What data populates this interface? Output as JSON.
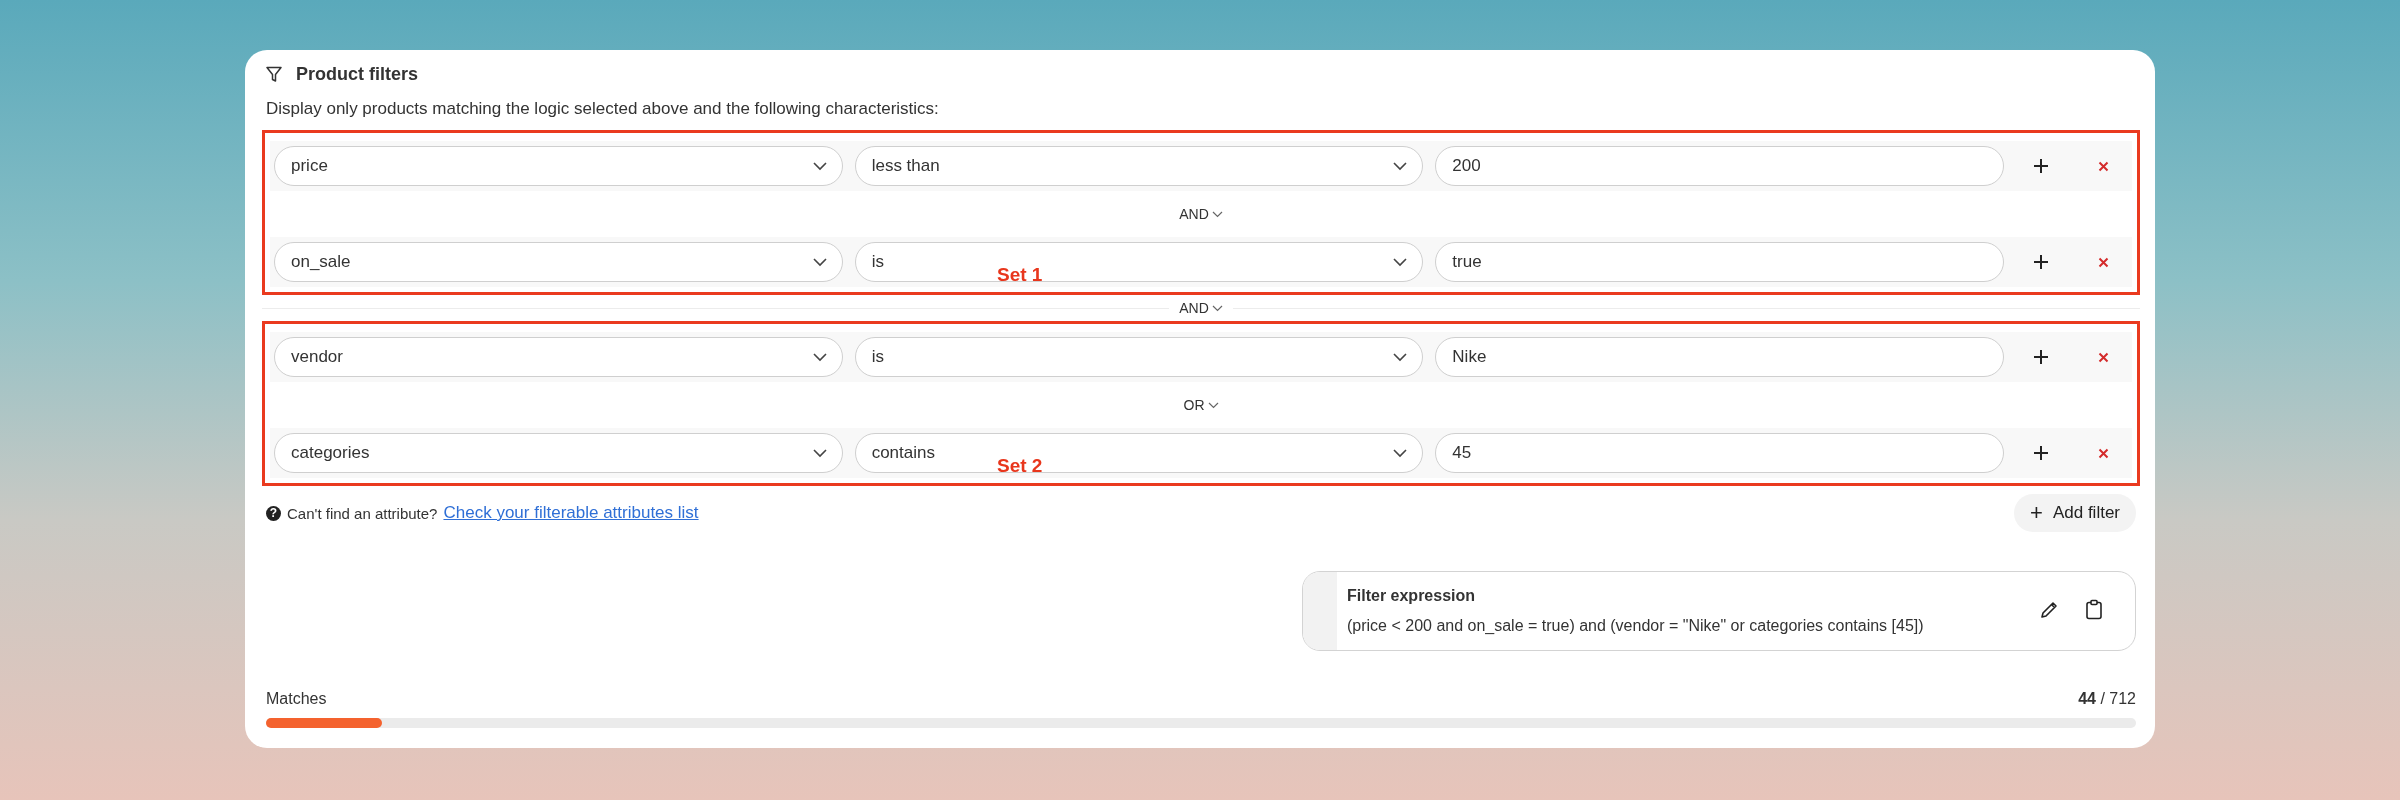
{
  "panel": {
    "title": "Product filters",
    "description": "Display only products matching the logic selected above and the following characteristics:",
    "sets": [
      {
        "label": "Set 1",
        "joins": [
          "AND"
        ],
        "filters": [
          {
            "attribute": "price",
            "operator": "less than",
            "value": "200"
          },
          {
            "attribute": "on_sale",
            "operator": "is",
            "value": "true"
          }
        ]
      },
      {
        "label": "Set 2",
        "joins": [
          "OR"
        ],
        "filters": [
          {
            "attribute": "vendor",
            "operator": "is",
            "value": "Nike"
          },
          {
            "attribute": "categories",
            "operator": "contains",
            "value": "45"
          }
        ]
      }
    ],
    "set_join": "AND",
    "help": {
      "icon": "?",
      "text": "Can't find an attribute?",
      "link": "Check your filterable attributes list"
    },
    "add_filter": {
      "icon": "+",
      "label": "Add filter"
    },
    "expression": {
      "title": "Filter expression",
      "text": "(price < 200 and on_sale = true) and (vendor = \"Nike\" or categories contains [45])"
    },
    "matches": {
      "label": "Matches",
      "count": "**44** / 712",
      "level": 0.062
    }
  }
}
